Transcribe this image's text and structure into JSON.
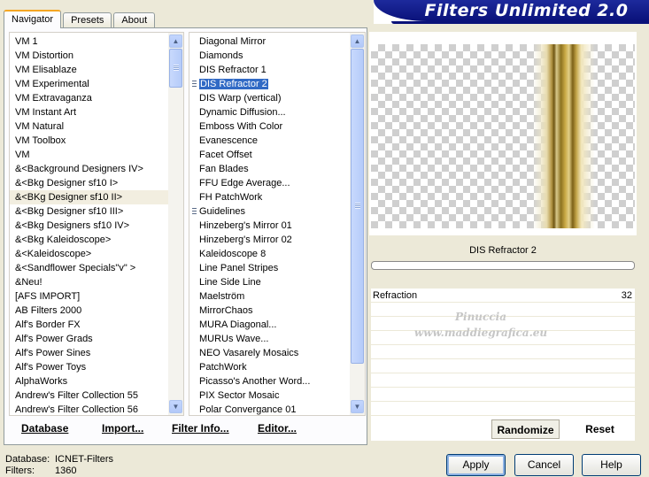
{
  "title": "Filters Unlimited 2.0",
  "tabs": [
    "Navigator",
    "Presets",
    "About"
  ],
  "categories": [
    "VM 1",
    "VM Distortion",
    "VM Elisablaze",
    "VM Experimental",
    "VM Extravaganza",
    "VM Instant Art",
    "VM Natural",
    "VM Toolbox",
    "VM",
    "&<Background Designers IV>",
    "&<Bkg Designer sf10 I>",
    "&<BKg Designer sf10 II>",
    "&<Bkg Designer sf10 III>",
    "&<Bkg Designers sf10 IV>",
    "&<Bkg Kaleidoscope>",
    "&<Kaleidoscope>",
    "&<Sandflower Specials\"v\" >",
    "&Neu!",
    "[AFS IMPORT]",
    "AB Filters 2000",
    "Alf's Border FX",
    "Alf's Power Grads",
    "Alf's Power Sines",
    "Alf's Power Toys",
    "AlphaWorks",
    "Andrew's Filter Collection 55",
    "Andrew's Filter Collection 56"
  ],
  "categories_highlighted_index": 11,
  "filters": [
    "Diagonal Mirror",
    "Diamonds",
    "DIS Refractor 1",
    "DIS Refractor 2",
    "DIS Warp (vertical)",
    "Dynamic Diffusion...",
    "Emboss With Color",
    "Evanescence",
    "Facet Offset",
    "Fan Blades",
    "FFU Edge Average...",
    "FH PatchWork",
    "Guidelines",
    "Hinzeberg's Mirror 01",
    "Hinzeberg's Mirror 02",
    "Kaleidoscope 8",
    "Line Panel Stripes",
    "Line Side Line",
    "Maelström",
    "MirrorChaos",
    "MURA Diagonal...",
    "MURUs Wave...",
    "NEO Vasarely Mosaics",
    "PatchWork",
    "Picasso's Another Word...",
    "PIX Sector Mosaic",
    "Polar Convergance 01"
  ],
  "filters_selected_index": 3,
  "filters_grip_indices": [
    3,
    12
  ],
  "bottom_links": [
    "Database",
    "Import...",
    "Filter Info...",
    "Editor..."
  ],
  "current_filter": "DIS Refractor 2",
  "parameters": [
    {
      "name": "Refraction",
      "value": "32"
    }
  ],
  "watermark": [
    "Pinuccia",
    "www.maddiegrafica.eu"
  ],
  "randomize_label": "Randomize",
  "reset_label": "Reset",
  "footer": {
    "database_label": "Database:",
    "database_value": "ICNET-Filters",
    "filters_label": "Filters:",
    "filters_value": "1360"
  },
  "buttons": {
    "apply": "Apply",
    "cancel": "Cancel",
    "help": "Help"
  }
}
